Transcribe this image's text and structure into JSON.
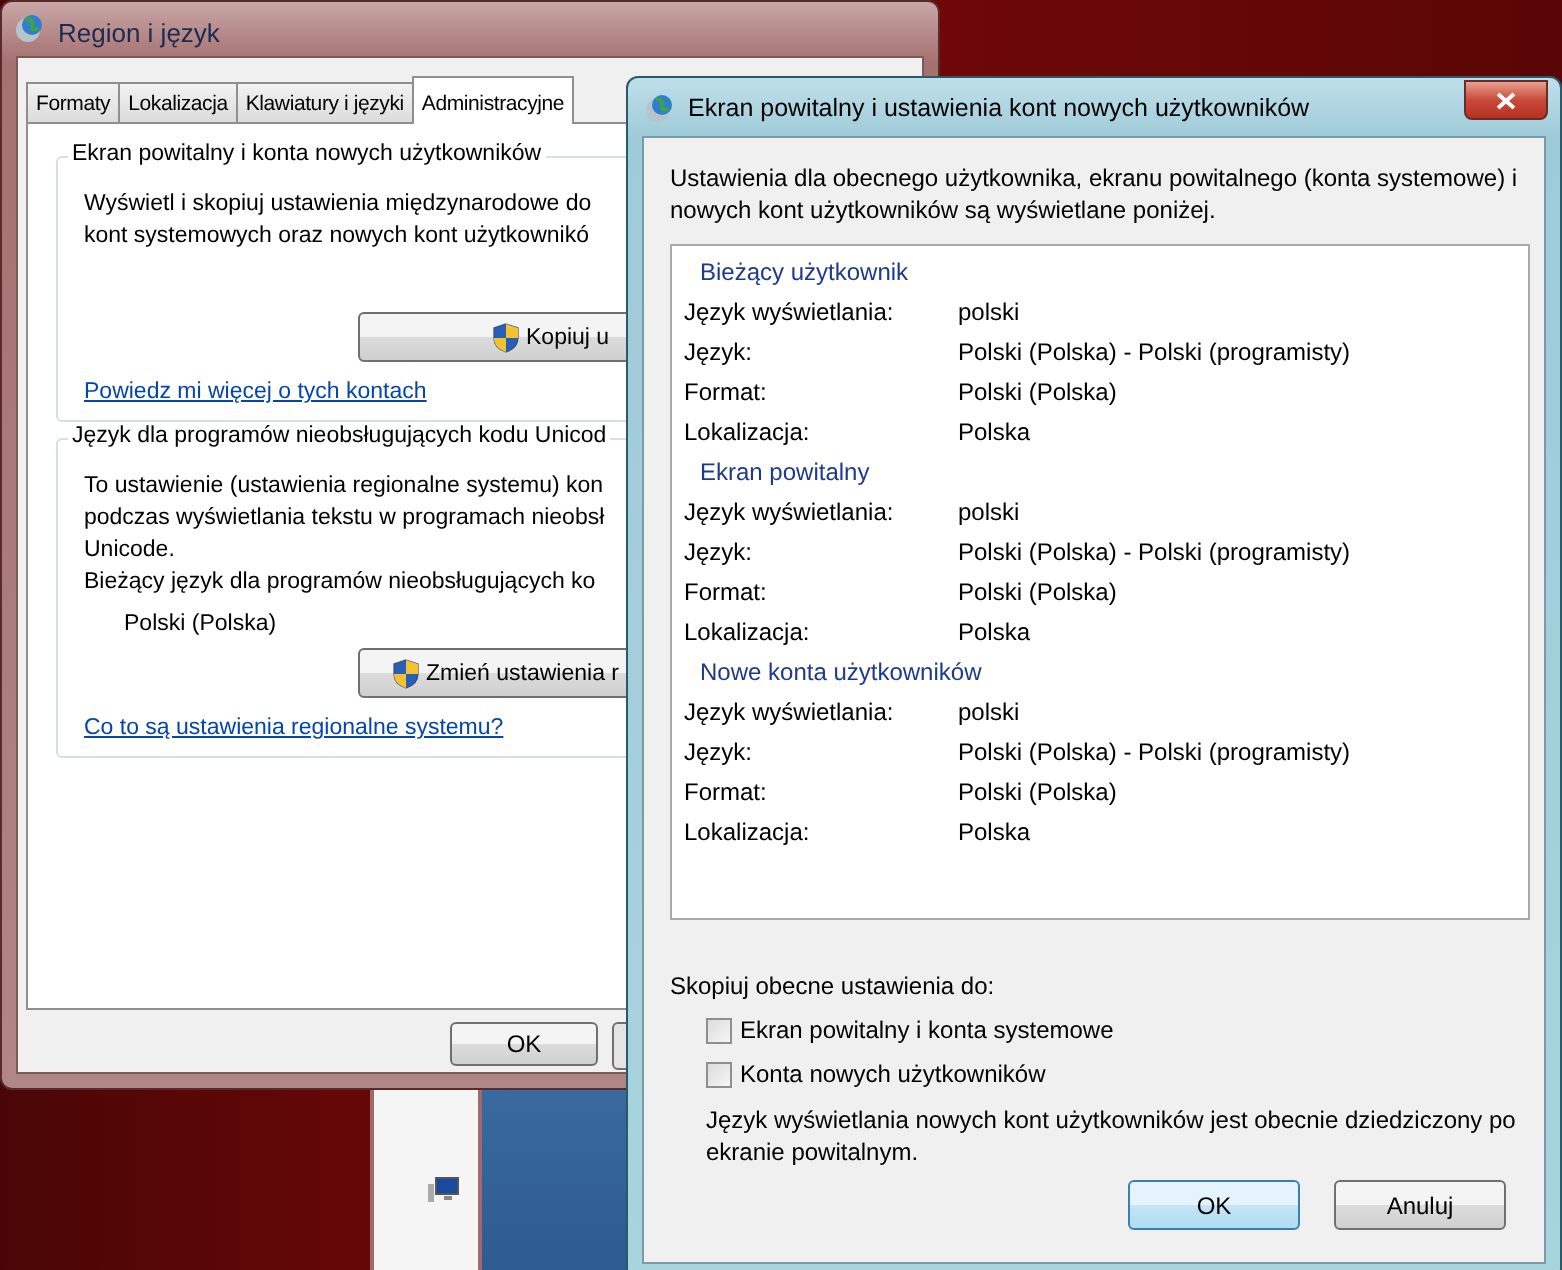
{
  "back_window": {
    "title": "Region i język",
    "tabs": [
      {
        "label": "Formaty",
        "selected": false
      },
      {
        "label": "Lokalizacja",
        "selected": false
      },
      {
        "label": "Klawiatury i języki",
        "selected": false
      },
      {
        "label": "Administracyjne",
        "selected": true
      }
    ],
    "groups": [
      {
        "title": "Ekran powitalny i konta nowych użytkowników",
        "lines": [
          "Wyświetl i skopiuj ustawienia międzynarodowe do",
          "kont systemowych oraz nowych kont użytkownikó"
        ],
        "button": "Kopiuj u",
        "link": "Powiedz mi więcej o tych kontach"
      },
      {
        "title": "Język dla programów nieobsługujących kodu Unicod",
        "lines": [
          "To ustawienie (ustawienia regionalne systemu) kon",
          "podczas wyświetlania tekstu w programach nieobsł",
          "Unicode.",
          "Bieżący język dla programów nieobsługujących ko"
        ],
        "value": "Polski (Polska)",
        "button": "Zmień ustawienia r",
        "link": "Co to są ustawienia regionalne systemu?"
      }
    ],
    "ok_button": "OK"
  },
  "dialog": {
    "title": "Ekran powitalny i ustawienia kont nowych użytkowników",
    "intro": "Ustawienia dla obecnego użytkownika, ekranu powitalnego (konta systemowe) i nowych kont użytkowników są wyświetlane poniżej.",
    "sections": [
      {
        "heading": "Bieżący użytkownik",
        "rows": [
          {
            "label": "Język wyświetlania:",
            "value": "polski"
          },
          {
            "label": "Język:",
            "value": "Polski (Polska) - Polski (programisty)"
          },
          {
            "label": "Format:",
            "value": "Polski (Polska)"
          },
          {
            "label": "Lokalizacja:",
            "value": "Polska"
          }
        ]
      },
      {
        "heading": "Ekran powitalny",
        "rows": [
          {
            "label": "Język wyświetlania:",
            "value": "polski"
          },
          {
            "label": "Język:",
            "value": "Polski (Polska) - Polski (programisty)"
          },
          {
            "label": "Format:",
            "value": "Polski (Polska)"
          },
          {
            "label": "Lokalizacja:",
            "value": "Polska"
          }
        ]
      },
      {
        "heading": "Nowe konta użytkowników",
        "rows": [
          {
            "label": "Język wyświetlania:",
            "value": "polski"
          },
          {
            "label": "Język:",
            "value": "Polski (Polska) - Polski (programisty)"
          },
          {
            "label": "Format:",
            "value": "Polski (Polska)"
          },
          {
            "label": "Lokalizacja:",
            "value": "Polska"
          }
        ]
      }
    ],
    "copy_label": "Skopiuj obecne ustawienia do:",
    "checkboxes": [
      {
        "label": "Ekran powitalny i konta systemowe",
        "checked": false
      },
      {
        "label": "Konta nowych użytkowników",
        "checked": false
      }
    ],
    "note": "Język wyświetlania nowych kont użytkowników jest obecnie dziedziczony po ekranie powitalnym.",
    "buttons": [
      {
        "label": "OK",
        "default": true
      },
      {
        "label": "Anuluj",
        "default": false
      }
    ]
  }
}
